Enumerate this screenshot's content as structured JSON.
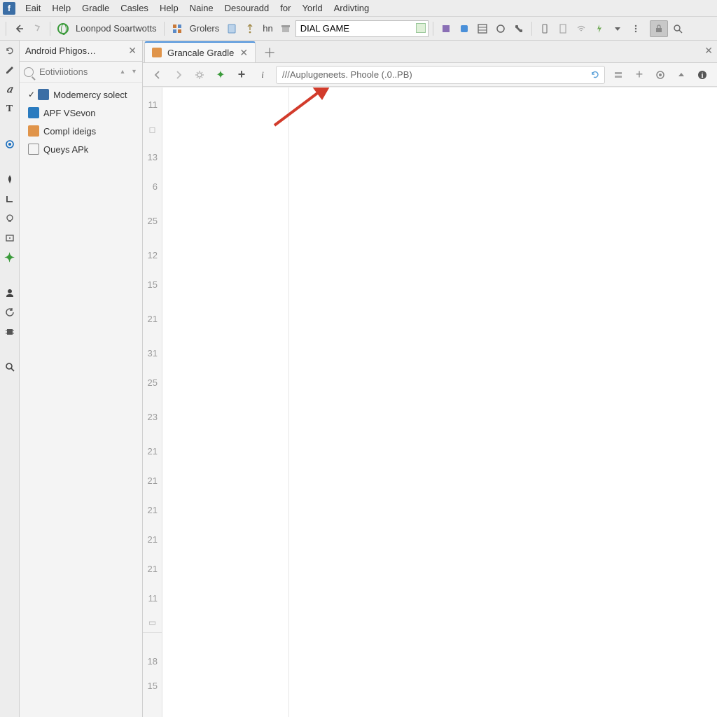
{
  "menu": {
    "items": [
      "Eait",
      "Help",
      "Gradle",
      "Casles",
      "Help",
      "Naine",
      "Desouradd",
      "for",
      "Yorld",
      "Ardivting"
    ]
  },
  "toolbar": {
    "project_label": "Loonpod Soartwotts",
    "dropdown_label": "Grolers",
    "hn_label": "hn",
    "search_value": "DIAL GAME"
  },
  "panel": {
    "tab_title": "Android Phigos…",
    "search_placeholder": "Eotiviiotions",
    "tree": [
      {
        "label": "Modemercy solect",
        "icon": "ic-blue",
        "swoosh": true
      },
      {
        "label": "APF VSevon",
        "icon": "ic-cyan"
      },
      {
        "label": "Compl ideigs",
        "icon": "ic-orange"
      },
      {
        "label": "Queys APk",
        "icon": "ic-grey"
      }
    ]
  },
  "editor": {
    "tab_title": "Grancale Gradle",
    "path_value": "///Auplugeneets.  Phoole  (.0..PB)",
    "gutter_lines": [
      "11",
      "",
      "13",
      "6",
      "25",
      "12",
      "15",
      "21",
      "31",
      "25",
      "23",
      "21",
      "21",
      "21",
      "21",
      "21",
      "11",
      "",
      "",
      "18",
      "15"
    ]
  }
}
